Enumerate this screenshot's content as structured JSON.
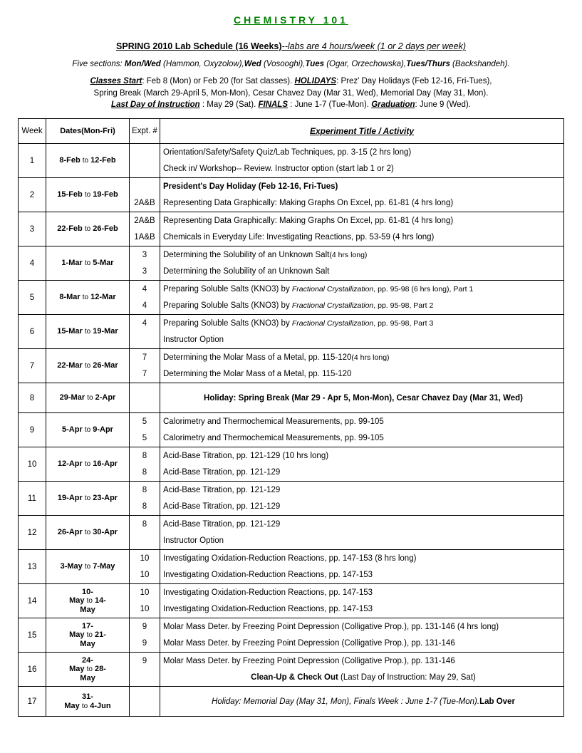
{
  "title": "CHEMISTRY 101",
  "subtitle_bold": "SPRING 2010 Lab Schedule (16 Weeks)",
  "subtitle_italic": "--labs are 4 hours/week (1 or 2 days per week)",
  "sections_label": "Five sections:",
  "sections_text": " Mon/Wed (Hammon, Oxyzolow), Wed (Vosooghi), Tues (Ogar, Orzechowska), Tues/Thurs (Backshandeh).",
  "info_line1a": "Classes Start",
  "info_line1b": ": Feb 8 (Mon) or Feb 20 (for Sat classes). ",
  "info_line1c": "HOLIDAYS",
  "info_line1d": ": Prez' Day Holidays (Feb 12-16, Fri-Tues),",
  "info_line2": "Spring Break (March 29-April 5, Mon-Mon), Cesar Chavez Day (Mar 31, Wed), Memorial Day (May 31, Mon).",
  "info_line3a": "Last Day of Instruction",
  "info_line3b": " : May 29 (Sat). ",
  "info_line3c": "FINALS",
  "info_line3d": " : June 1-7 (Tue-Mon). ",
  "info_line3e": "Graduation",
  "info_line3f": ":  June 9 (Wed).",
  "headers": {
    "week": "Week",
    "dates": "Dates(Mon-Fri)",
    "expt": "Expt. #",
    "activity": "Experiment Title / Activity"
  },
  "rows": [
    {
      "wk": "1",
      "d1": "8-Feb",
      "d2": "12-Feb",
      "r": [
        {
          "ex": "",
          "act": "Orientation/Safety/Safety Quiz/Lab Techniques, pp. 3-15 (2 hrs long)"
        },
        {
          "ex": "",
          "act": "Check in/ Workshop-- Review.  Instructor option (start lab 1 or 2)"
        }
      ]
    },
    {
      "wk": "2",
      "d1": "15-Feb",
      "d2": "19-Feb",
      "r": [
        {
          "ex": "",
          "act": "President's Day Holiday (Feb 12-16, Fri-Tues)",
          "bold": true
        },
        {
          "ex": "2A&B",
          "act": "Representing Data Graphically: Making Graphs On Excel, pp. 61-81  (4 hrs long)"
        }
      ]
    },
    {
      "wk": "3",
      "d1": "22-Feb",
      "d2": "26-Feb",
      "r": [
        {
          "ex": "2A&B",
          "act": "Representing Data Graphically: Making Graphs On Excel, pp. 61-81  (4 hrs long)"
        },
        {
          "ex": "1A&B",
          "act": "Chemicals in Everyday Life: Investigating Reactions, pp. 53-59 (4 hrs long)"
        }
      ]
    },
    {
      "wk": "4",
      "d1": "1-Mar",
      "d2": "5-Mar",
      "r": [
        {
          "ex": "3",
          "act": "Determining the Solubility of an Unknown Salt",
          "note": "(4 hrs long)"
        },
        {
          "ex": "3",
          "act": "Determining the Solubility of an Unknown Salt"
        }
      ]
    },
    {
      "wk": "5",
      "d1": "8-Mar",
      "d2": "12-Mar",
      "r": [
        {
          "ex": "4",
          "act": "Preparing Soluble Salts (KNO3) by Fractional Crystallization, pp. 95-98 (6 hrs long), Part 1",
          "mixed": true
        },
        {
          "ex": "4",
          "act": "Preparing Soluble Salts (KNO3) by Fractional Crystallization, pp. 95-98, Part 2",
          "mixed": true
        }
      ]
    },
    {
      "wk": "6",
      "d1": "15-Mar",
      "d2": "19-Mar",
      "r": [
        {
          "ex": "4",
          "act": "Preparing Soluble Salts (KNO3) by Fractional Crystallization, pp. 95-98, Part 3",
          "mixed": true
        },
        {
          "ex": "",
          "act": "Instructor Option"
        }
      ]
    },
    {
      "wk": "7",
      "d1": "22-Mar",
      "d2": "26-Mar",
      "r": [
        {
          "ex": "7",
          "act": "Determining the Molar Mass of a Metal, pp. 115-120",
          "note": "(4 hrs long)"
        },
        {
          "ex": "7",
          "act": "Determining the Molar Mass of a Metal, pp. 115-120"
        }
      ]
    },
    {
      "wk": "8",
      "d1": "29-Mar",
      "d2": "2-Apr",
      "single": true,
      "holiday": "Holiday: Spring Break (Mar 29 - Apr 5, Mon-Mon), Cesar Chavez Day (Mar 31, Wed)"
    },
    {
      "wk": "9",
      "d1": "5-Apr",
      "d2": "9-Apr",
      "r": [
        {
          "ex": "5",
          "act": "Calorimetry and Thermochemical Measurements, pp. 99-105"
        },
        {
          "ex": "5",
          "act": "Calorimetry and Thermochemical Measurements, pp. 99-105"
        }
      ]
    },
    {
      "wk": "10",
      "d1": "12-Apr",
      "d2": "16-Apr",
      "r": [
        {
          "ex": "8",
          "act": "Acid-Base Titration, pp. 121-129 (10 hrs long)"
        },
        {
          "ex": "8",
          "act": "Acid-Base Titration, pp. 121-129"
        }
      ]
    },
    {
      "wk": "11",
      "d1": "19-Apr",
      "d2": "23-Apr",
      "r": [
        {
          "ex": "8",
          "act": "Acid-Base Titration, pp. 121-129"
        },
        {
          "ex": "8",
          "act": "Acid-Base Titration, pp. 121-129"
        }
      ]
    },
    {
      "wk": "12",
      "d1": "26-Apr",
      "d2": "30-Apr",
      "r": [
        {
          "ex": "8",
          "act": "Acid-Base Titration, pp. 121-129"
        },
        {
          "ex": "",
          "act": "Instructor Option"
        }
      ]
    },
    {
      "wk": "13",
      "d1": "3-May",
      "d2": "7-May",
      "r": [
        {
          "ex": "10",
          "act": "Investigating Oxidation-Reduction Reactions, pp. 147-153 (8 hrs long)"
        },
        {
          "ex": "10",
          "act": "Investigating Oxidation-Reduction Reactions, pp. 147-153"
        }
      ]
    },
    {
      "wk": "14",
      "d1": "10-May",
      "d2": "14-May",
      "stack": true,
      "r": [
        {
          "ex": "10",
          "act": "Investigating Oxidation-Reduction Reactions, pp. 147-153"
        },
        {
          "ex": "10",
          "act": "Investigating Oxidation-Reduction Reactions, pp. 147-153"
        }
      ]
    },
    {
      "wk": "15",
      "d1": "17-May",
      "d2": "21-May",
      "stack": true,
      "r": [
        {
          "ex": "9",
          "act": "Molar Mass Deter. by Freezing Point Depression (Colligative Prop.), pp. 131-146 (4 hrs long)"
        },
        {
          "ex": "9",
          "act": "Molar Mass Deter. by Freezing Point Depression (Colligative Prop.), pp. 131-146"
        }
      ]
    },
    {
      "wk": "16",
      "d1": "24-May",
      "d2": "28-May",
      "stack": true,
      "r": [
        {
          "ex": "9",
          "act": "Molar Mass Deter. by Freezing Point Depression (Colligative Prop.), pp. 131-146"
        },
        {
          "ex": "",
          "cleanup": true,
          "act_b": "Clean-Up & Check Out",
          "act_n": " (Last Day of Instruction: May 29, Sat)"
        }
      ]
    },
    {
      "wk": "17",
      "d1": "31-May",
      "d2": "4-Jun",
      "stack17": true,
      "single": true,
      "final_italic": "Holiday:  Memorial Day (May 31, Mon),  Finals Week : June 1-7 (Tue-Mon).",
      "final_bold": "Lab Over"
    }
  ]
}
